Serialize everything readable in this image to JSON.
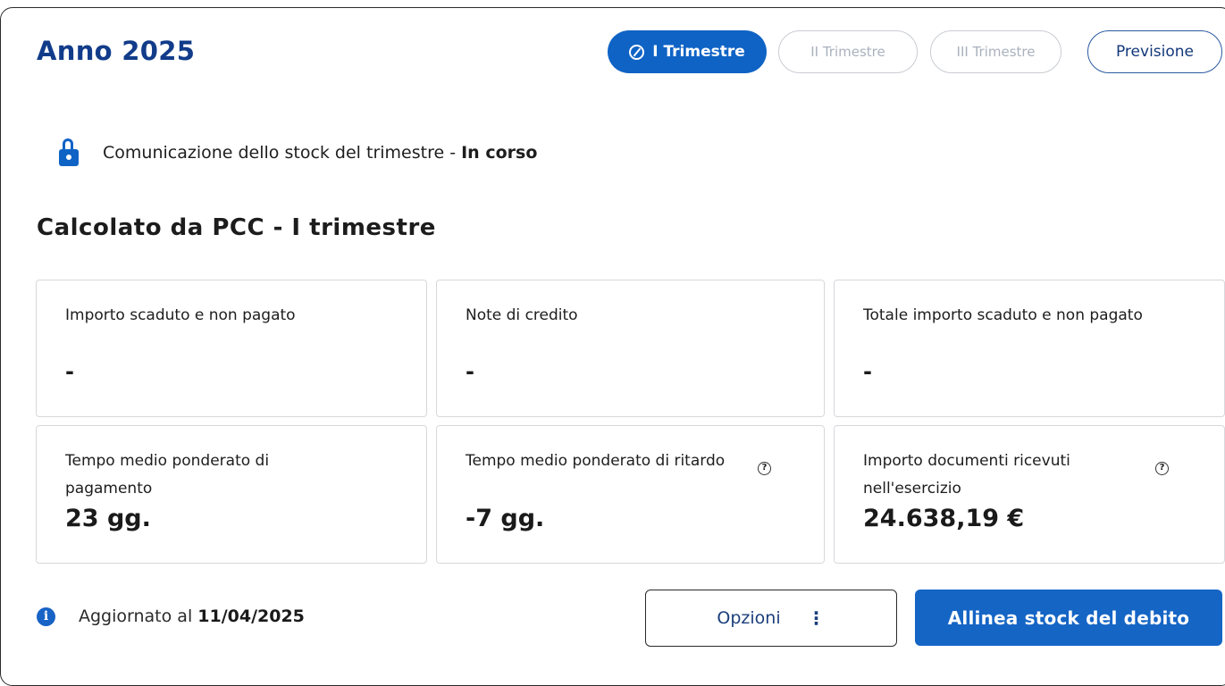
{
  "header": {
    "title": "Anno 2025"
  },
  "tabs": [
    {
      "label": "I Trimestre",
      "state": "active"
    },
    {
      "label": "II Trimestre",
      "state": "disabled"
    },
    {
      "label": "III Trimestre",
      "state": "disabled"
    },
    {
      "label": "Previsione",
      "state": "enabled"
    }
  ],
  "status": {
    "icon": "lock-icon",
    "text": "Comunicazione dello stock del trimestre - ",
    "state": "In corso"
  },
  "section": {
    "title": "Calcolato da PCC - I trimestre"
  },
  "metrics": [
    {
      "label": "Importo scaduto e non pagato",
      "value": "-",
      "help": false
    },
    {
      "label": "Note di credito",
      "value": "-",
      "help": false
    },
    {
      "label": "Totale importo scaduto e non pagato",
      "value": "-",
      "help": false
    },
    {
      "label": "Tempo medio ponderato di pagamento",
      "value": "23 gg.",
      "help": false
    },
    {
      "label": "Tempo medio ponderato di ritardo",
      "value": "-7 gg.",
      "help": true
    },
    {
      "label": "Importo documenti ricevuti nell'esercizio",
      "value": "24.638,19 €",
      "help": true
    }
  ],
  "footer": {
    "updated_prefix": "Aggiornato al ",
    "updated_date": "11/04/2025",
    "options_label": "Opzioni",
    "options_icon": "⋮",
    "primary_label": "Allinea stock del debito"
  },
  "colors": {
    "primary": "#1565c5",
    "title": "#123c8a"
  }
}
